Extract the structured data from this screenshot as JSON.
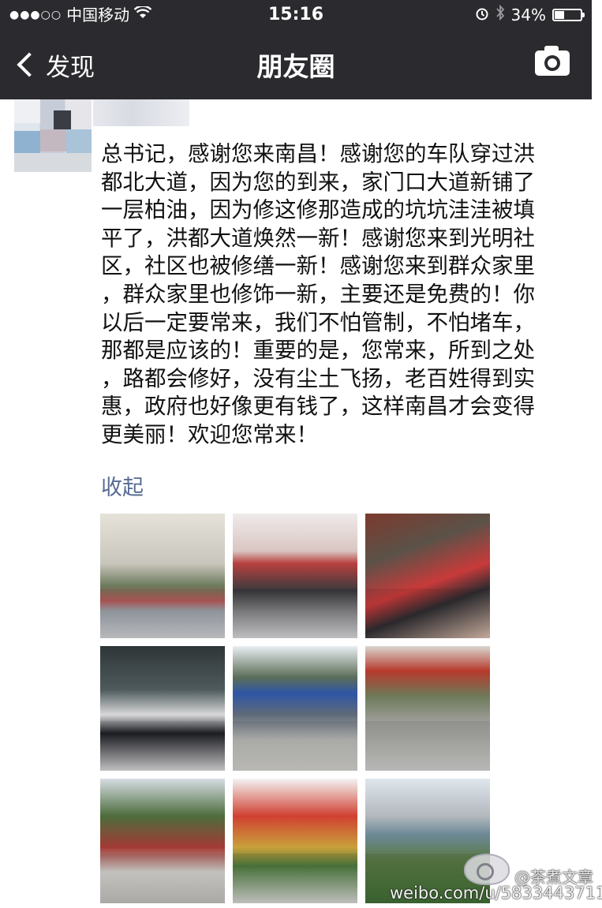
{
  "status_bar": {
    "signal": "●●●○○",
    "carrier": "中国移动",
    "time": "15:16",
    "battery": "34%",
    "battery_level": 0.34
  },
  "nav": {
    "back_label": "发现",
    "title": "朋友圈"
  },
  "post": {
    "text": "总书记，感谢您来南昌！感谢您的车队穿过洪\n都北大道，因为您的到来，家门口大道新铺了\n一层柏油，因为修这修那造成的坑坑洼洼被填\n平了，洪都大道焕然一新！感谢您来到光明社\n区，社区也被修缮一新！感谢您来到群众家里\n，群众家里也修饰一新，主要还是免费的！你\n以后一定要常来，我们不怕管制，不怕堵车，\n那都是应该的！重要的是，您常来，所到之处\n，路都会修好，没有尘土飞扬，老百姓得到实\n惠，政府也好像更有钱了，这样南昌才会变得\n更美丽！欢迎您常来！",
    "collapse_label": "收起"
  },
  "watermark": {
    "name": "@茶煮文章",
    "url": "weibo.com/u/5833443711"
  },
  "colors": {
    "nav_bg": "#2b2b2f",
    "link": "#576b95"
  }
}
